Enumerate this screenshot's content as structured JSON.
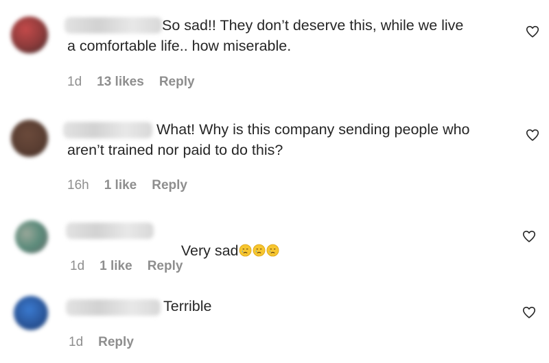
{
  "comments": [
    {
      "text": "So sad!! They don’t deserve this, while we live\na comfortable life.. how miserable.",
      "time": "1d",
      "likes": "13 likes",
      "reply": "Reply",
      "avatar_colors": [
        "#8a3a3a",
        "#c44a4a",
        "#3a2a2a"
      ]
    },
    {
      "text": "What! Why is this company sending people who\naren’t trained nor paid to do this?",
      "time": "16h",
      "likes": "1 like",
      "reply": "Reply",
      "avatar_colors": [
        "#5a3e32",
        "#6b4a3b",
        "#3f2a22"
      ]
    },
    {
      "text": "Very sad",
      "emojis": [
        "crying-face-emoji",
        "crying-face-emoji",
        "crying-face-emoji"
      ],
      "time": "1d",
      "likes": "1 like",
      "reply": "Reply",
      "avatar_colors": [
        "#9aa89a",
        "#5a8a7a",
        "#6a6a6a"
      ]
    },
    {
      "text": "Terrible",
      "time": "1d",
      "likes": "",
      "reply": "Reply",
      "avatar_colors": [
        "#2c5aa0",
        "#3a7ad0",
        "#1a3a70"
      ]
    }
  ],
  "heart_icon": "heart-outline-icon",
  "colors": {
    "text": "#262626",
    "meta": "#8e8e8e"
  }
}
